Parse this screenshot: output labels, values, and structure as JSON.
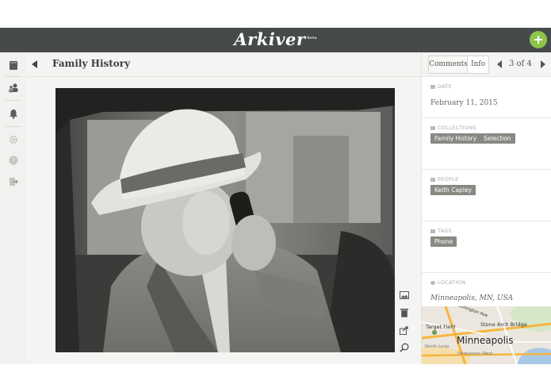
{
  "app": {
    "name": "Arkiver",
    "badge": "beta"
  },
  "header": {
    "title": "Family History"
  },
  "tabs": [
    {
      "label": "Comments"
    },
    {
      "label": "Info"
    }
  ],
  "pager": {
    "text": "3 of 4"
  },
  "info": {
    "date": {
      "label": "DATE",
      "value": "February 11, 2015"
    },
    "collections": {
      "label": "COLLECTIONS",
      "items": [
        "Family History",
        "Selection"
      ]
    },
    "people": {
      "label": "PEOPLE",
      "items": [
        "Keith Capley"
      ]
    },
    "tags": {
      "label": "TAGS",
      "items": [
        "Phone"
      ]
    },
    "location": {
      "label": "LOCATION",
      "value": "Minneapolis, MN, USA"
    }
  },
  "map": {
    "city": "Minneapolis",
    "labels": [
      "Target Field",
      "Stone Arch Bridge",
      "Washington Ave",
      "North Loop",
      "Downtown West"
    ]
  },
  "icons": {
    "sidebar": [
      "book-icon",
      "people-icon",
      "bell-icon",
      "gear-icon",
      "help-icon",
      "logout-icon"
    ],
    "tools": [
      "image-icon",
      "trash-icon",
      "share-icon",
      "zoom-icon"
    ]
  },
  "colors": {
    "topbar": "#474a4b",
    "accent": "#8fc44a",
    "chip": "#8a8883"
  }
}
